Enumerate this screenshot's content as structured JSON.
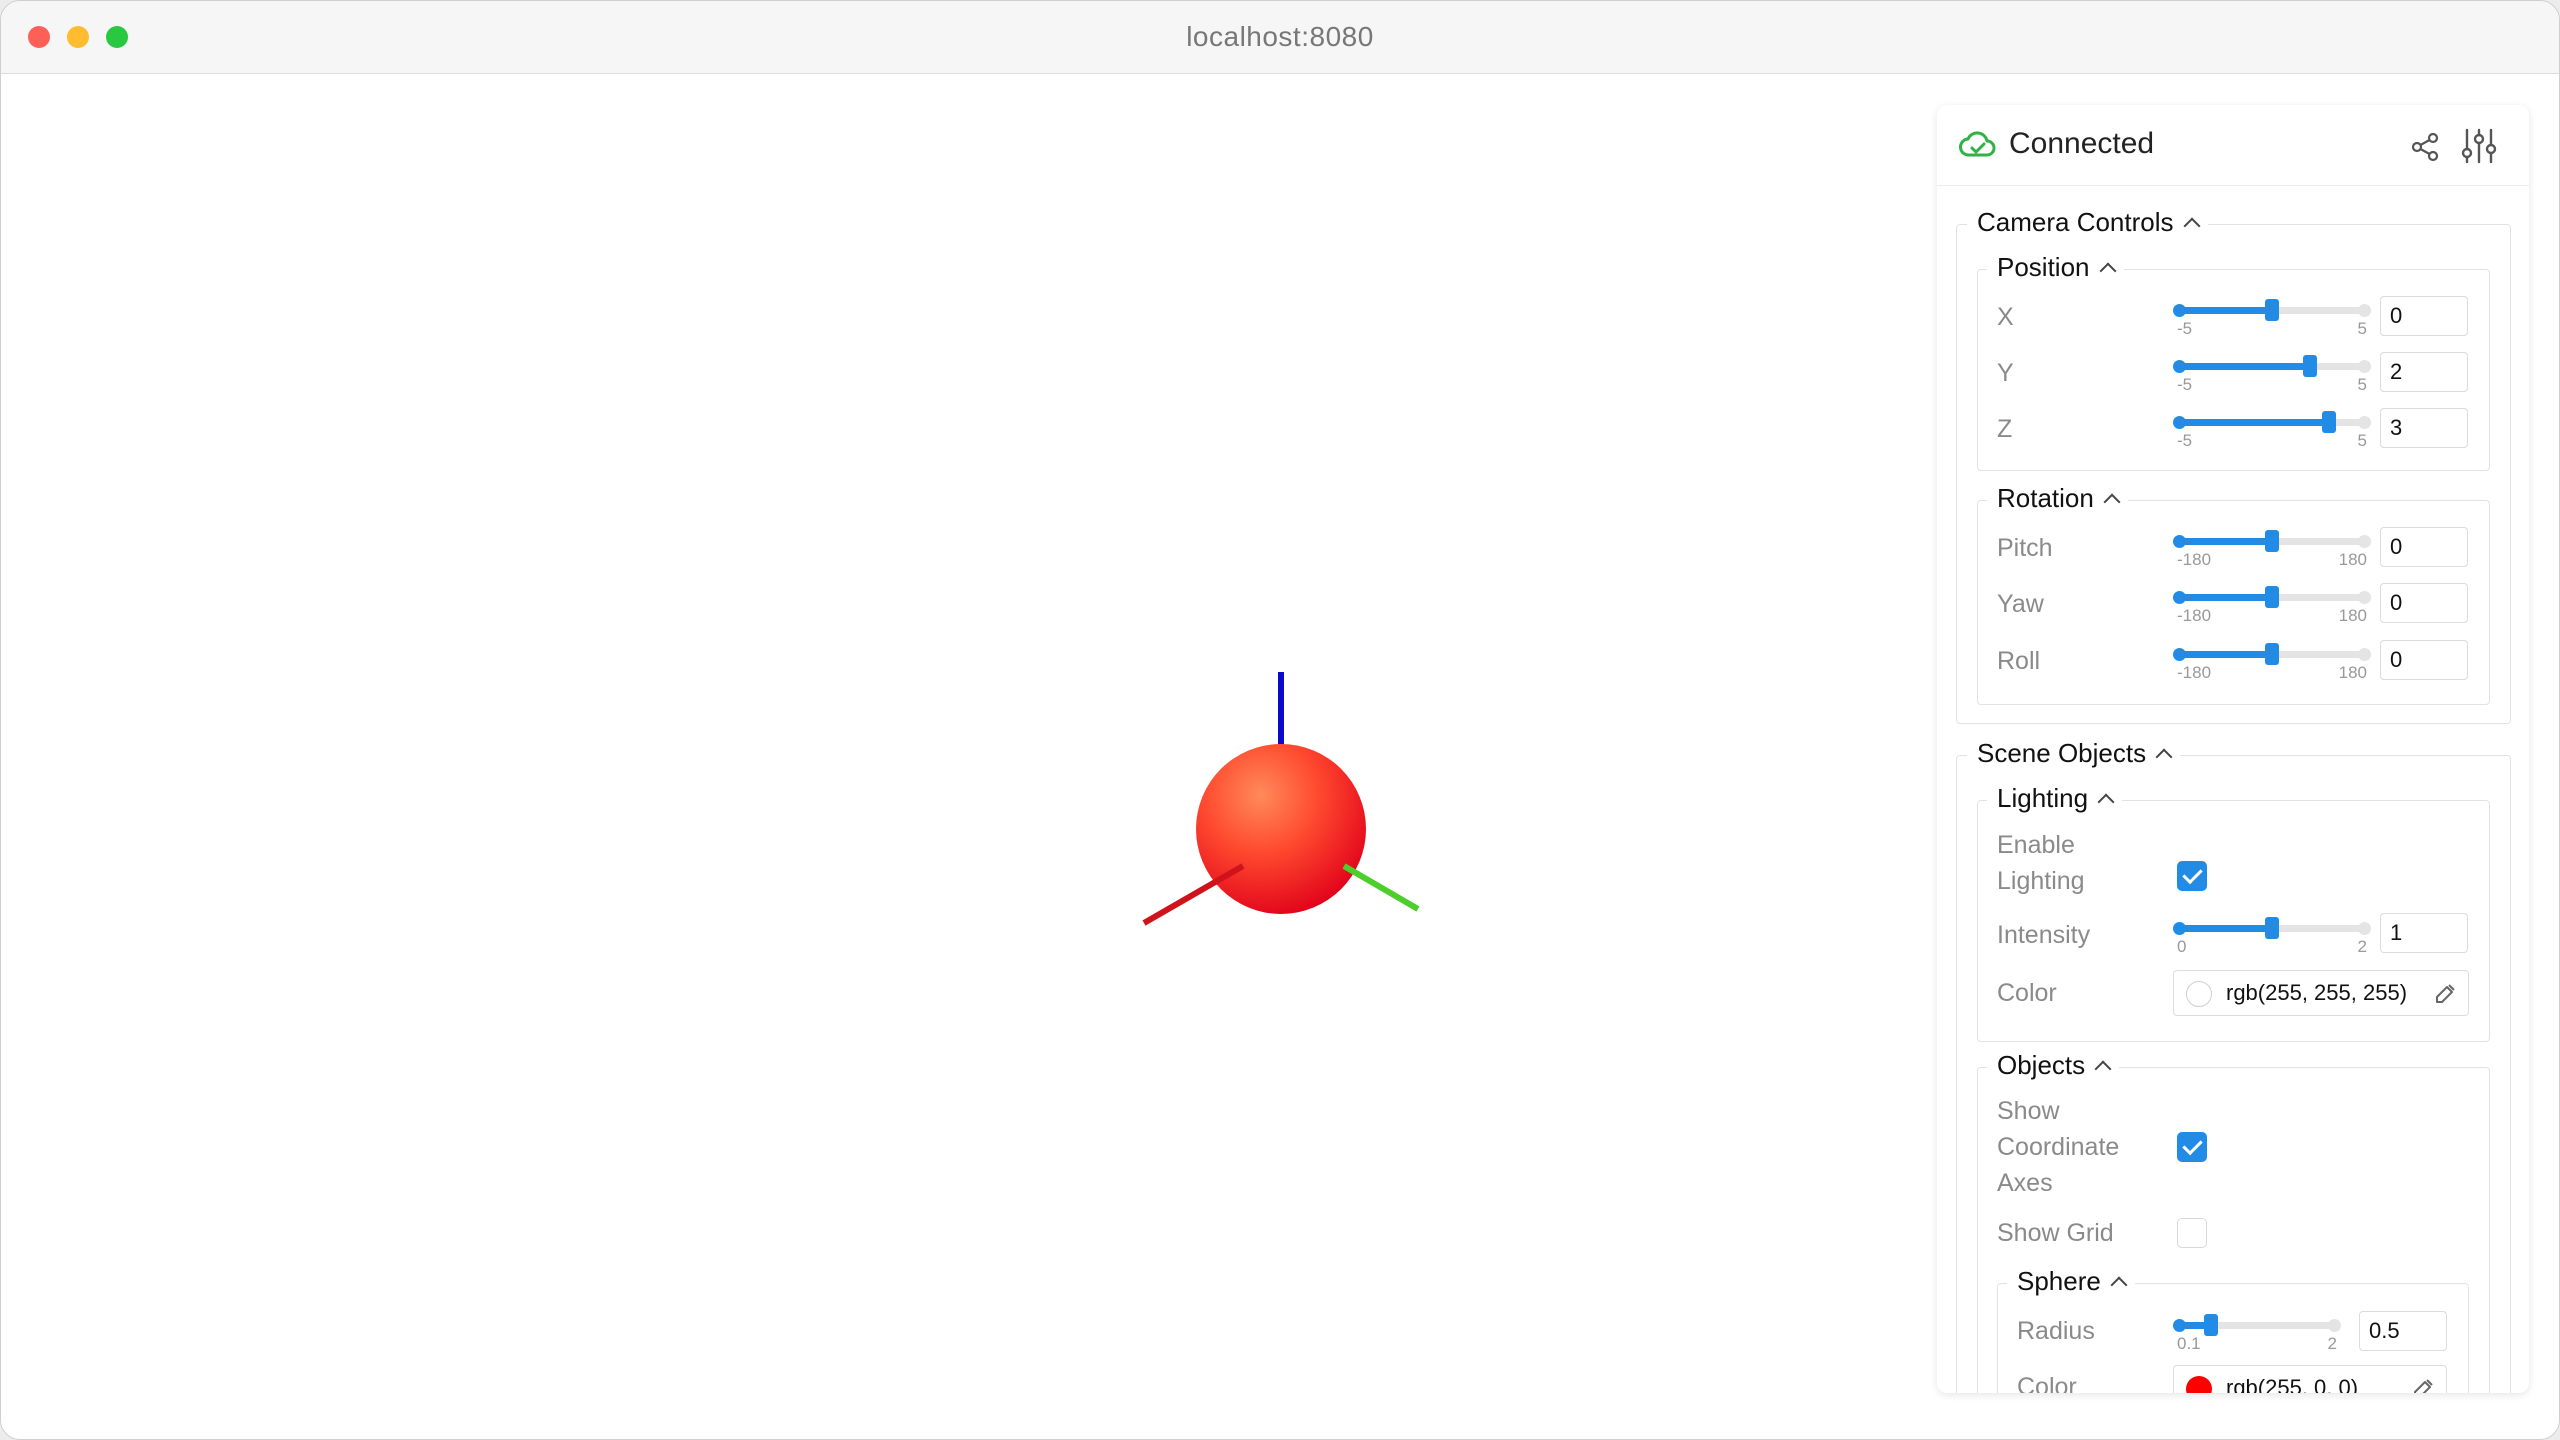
{
  "browser": {
    "url": "localhost:8080"
  },
  "panel": {
    "status": "Connected",
    "colors": {
      "accent": "#228be6",
      "connected": "#2fb344"
    }
  },
  "camera": {
    "title": "Camera Controls",
    "position": {
      "title": "Position",
      "x": {
        "label": "X",
        "min": "-5",
        "max": "5",
        "value": "0"
      },
      "y": {
        "label": "Y",
        "min": "-5",
        "max": "5",
        "value": "2"
      },
      "z": {
        "label": "Z",
        "min": "-5",
        "max": "5",
        "value": "3"
      }
    },
    "rotation": {
      "title": "Rotation",
      "pitch": {
        "label": "Pitch",
        "min": "-180",
        "max": "180",
        "value": "0"
      },
      "yaw": {
        "label": "Yaw",
        "min": "-180",
        "max": "180",
        "value": "0"
      },
      "roll": {
        "label": "Roll",
        "min": "-180",
        "max": "180",
        "value": "0"
      }
    }
  },
  "scene": {
    "title": "Scene Objects",
    "lighting": {
      "title": "Lighting",
      "enable_label_1": "Enable",
      "enable_label_2": "Lighting",
      "enabled": true,
      "intensity": {
        "label": "Intensity",
        "min": "0",
        "max": "2",
        "value": "1"
      },
      "color": {
        "label": "Color",
        "value": "rgb(255, 255, 255)",
        "swatch": "#ffffff"
      }
    },
    "objects": {
      "title": "Objects",
      "axes_label_1": "Show",
      "axes_label_2": "Coordinate",
      "axes_label_3": "Axes",
      "show_axes": true,
      "grid_label": "Show Grid",
      "show_grid": false,
      "sphere": {
        "title": "Sphere",
        "radius": {
          "label": "Radius",
          "min": "0.1",
          "max": "2",
          "value": "0.5"
        },
        "color": {
          "label": "Color",
          "value": "rgb(255, 0, 0)",
          "swatch": "#ff0000"
        }
      }
    }
  },
  "viewport": {
    "sphere_color": "#ff3b2f",
    "axis_colors": {
      "x": "#d0131b",
      "y": "#4ccf2a",
      "z": "#0a0ac8"
    }
  }
}
